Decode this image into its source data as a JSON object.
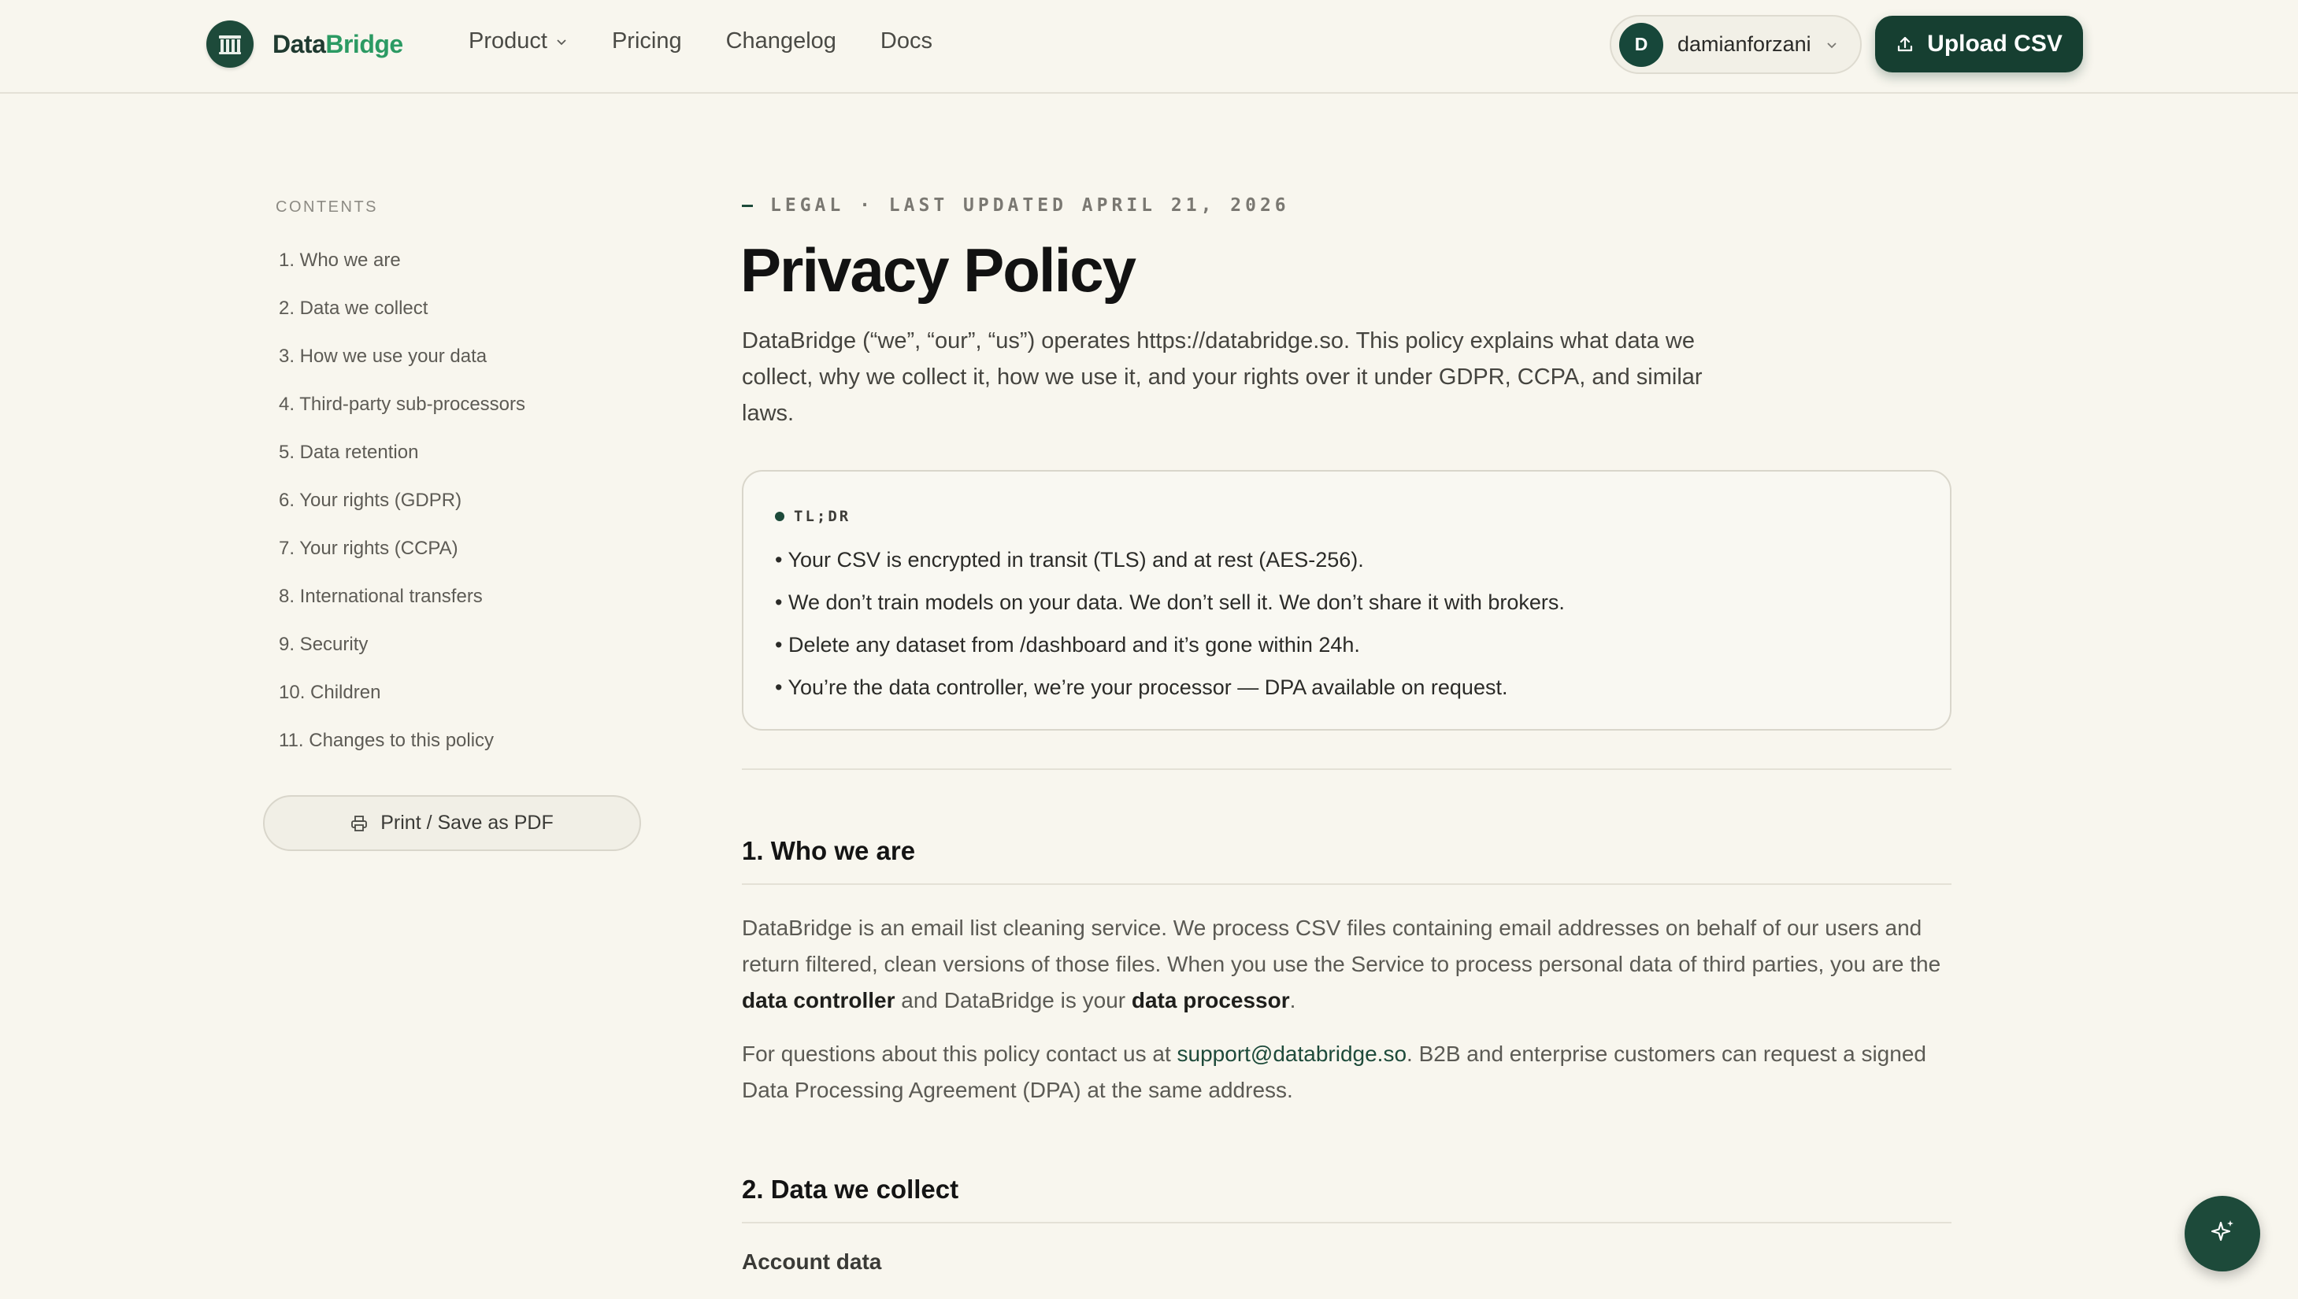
{
  "header": {
    "brand_part1": "Data",
    "brand_part2": "Bridge",
    "nav": [
      {
        "label": "Product"
      },
      {
        "label": "Pricing"
      },
      {
        "label": "Changelog"
      },
      {
        "label": "Docs"
      }
    ],
    "user": {
      "initial": "D",
      "name": "damianforzani"
    },
    "upload_label": "Upload CSV"
  },
  "sidebar": {
    "title": "CONTENTS",
    "items": [
      "1. Who we are",
      "2. Data we collect",
      "3. How we use your data",
      "4. Third-party sub-processors",
      "5. Data retention",
      "6. Your rights (GDPR)",
      "7. Your rights (CCPA)",
      "8. International transfers",
      "9. Security",
      "10. Children",
      "11. Changes to this policy"
    ],
    "print_label": "Print / Save as PDF"
  },
  "main": {
    "eyebrow": "LEGAL · LAST UPDATED APRIL 21, 2026",
    "title": "Privacy Policy",
    "intro": "DataBridge (“we”, “our”, “us”) operates https://databridge.so. This policy explains what data we collect, why we collect it, how we use it, and your rights over it under GDPR, CCPA, and similar laws.",
    "tldr": {
      "label": "TL;DR",
      "items": [
        "• Your CSV is encrypted in transit (TLS) and at rest (AES-256).",
        "• We don’t train models on your data. We don’t sell it. We don’t share it with brokers.",
        "• Delete any dataset from /dashboard and it’s gone within 24h.",
        "• You’re the data controller, we’re your processor — DPA available on request."
      ]
    },
    "section1": {
      "heading": "1. Who we are",
      "p1_a": "DataBridge is an email list cleaning service. We process CSV files containing email addresses on behalf of our users and return filtered, clean versions of those files. When you use the Service to process personal data of third parties, you are the ",
      "p1_b": "data controller",
      "p1_c": " and DataBridge is your ",
      "p1_d": "data processor",
      "p1_e": ".",
      "p2_a": "For questions about this policy contact us at ",
      "p2_link": "support@databridge.so",
      "p2_b": ". B2B and enterprise customers can request a signed Data Processing Agreement (DPA) at the same address."
    },
    "section2": {
      "heading": "2. Data we collect",
      "subheading": "Account data"
    }
  },
  "colors": {
    "background": "#f8f6ee",
    "brand_dark": "#163f31",
    "brand_green": "#2b9a63"
  }
}
